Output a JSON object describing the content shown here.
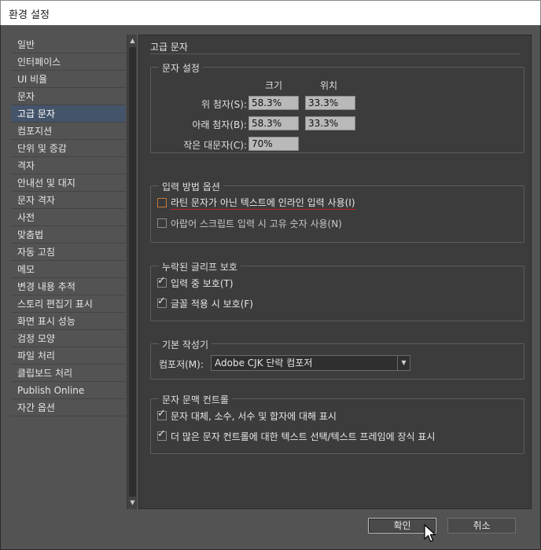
{
  "window": {
    "title": "환경 설정"
  },
  "sidebar": {
    "selected_index": 4,
    "items": [
      {
        "label": "일반"
      },
      {
        "label": "인터페이스"
      },
      {
        "label": "UI 비율"
      },
      {
        "label": "문자"
      },
      {
        "label": "고급 문자"
      },
      {
        "label": "컴포지션"
      },
      {
        "label": "단위 및 증감"
      },
      {
        "label": "격자"
      },
      {
        "label": "안내선 및 대지"
      },
      {
        "label": "문자 격자"
      },
      {
        "label": "사전"
      },
      {
        "label": "맞춤법"
      },
      {
        "label": "자동 고침"
      },
      {
        "label": "메모"
      },
      {
        "label": "변경 내용 추적"
      },
      {
        "label": "스토리 편집기 표시"
      },
      {
        "label": "화면 표시 성능"
      },
      {
        "label": "검정 모양"
      },
      {
        "label": "파일 처리"
      },
      {
        "label": "클립보드 처리"
      },
      {
        "label": "Publish Online"
      },
      {
        "label": "자간 옵션"
      }
    ]
  },
  "main": {
    "title": "고급 문자",
    "char_settings": {
      "label": "문자 설정",
      "col_size": "크기",
      "col_position": "위치",
      "superscript_label": "위 첨자(S):",
      "superscript_size": "58.3%",
      "superscript_position": "33.3%",
      "subscript_label": "아래 첨자(B):",
      "subscript_size": "58.3%",
      "subscript_position": "33.3%",
      "smallcaps_label": "작은 대문자(C):",
      "smallcaps_size": "70%"
    },
    "input_method": {
      "label": "입력 방법 옵션",
      "inline_label": "라틴 문자가 아닌 텍스트에 인라인 입력 사용(I)",
      "inline_checked": false,
      "arabic_label": "아랍어 스크립트 입력 시 고유 숫자 사용(N)",
      "arabic_checked": false
    },
    "missing_glyph": {
      "label": "누락된 글리프 보호",
      "typing_label": "입력 중 보호(T)",
      "typing_checked": true,
      "font_apply_label": "글꼴 적용 시 보호(F)",
      "font_apply_checked": true
    },
    "default_composer": {
      "label": "기본 작성기",
      "composer_label": "컴포저(M):",
      "composer_value": "Adobe  CJK 단락 컴포저"
    },
    "context_controls": {
      "label": "문자 문맥 컨트롤",
      "alternates_label": "문자 대체, 소수, 서수 및 합자에 대해 표시",
      "alternates_checked": true,
      "more_controls_label": "더 많은 문자 컨트롤에 대한 텍스트 선택/텍스트 프레임에 장식 표시",
      "more_controls_checked": true
    }
  },
  "footer": {
    "ok_label": "확인",
    "cancel_label": "취소"
  }
}
